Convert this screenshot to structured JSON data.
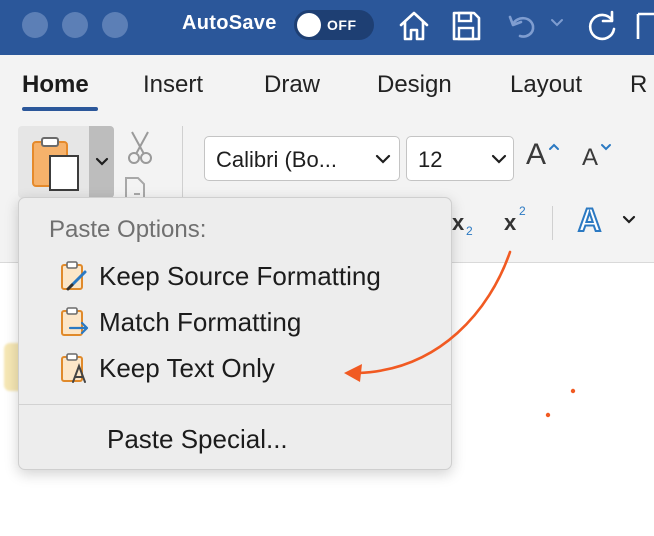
{
  "titlebar": {
    "autosave_label": "AutoSave",
    "toggle_state": "OFF"
  },
  "tabs": [
    {
      "label": "Home",
      "active": true
    },
    {
      "label": "Insert",
      "active": false
    },
    {
      "label": "Draw",
      "active": false
    },
    {
      "label": "Design",
      "active": false
    },
    {
      "label": "Layout",
      "active": false
    },
    {
      "label": "R",
      "active": false
    }
  ],
  "font": {
    "name": "Calibri (Bo...",
    "size": "12"
  },
  "format": {
    "subscript_label": "x",
    "subscript_mark": "2",
    "superscript_label": "x",
    "superscript_mark": "2",
    "grow_font": "A",
    "shrink_font": "A",
    "text_effects": "A"
  },
  "paste_menu": {
    "header": "Paste Options:",
    "items": [
      {
        "label": "Keep Source Formatting",
        "icon": "clipboard-brush-icon"
      },
      {
        "label": "Match Formatting",
        "icon": "clipboard-arrow-icon"
      },
      {
        "label": "Keep Text Only",
        "icon": "clipboard-text-icon",
        "highlighted": true
      }
    ],
    "special": "Paste Special..."
  },
  "colors": {
    "titlebar": "#2b579a",
    "annotation_arrow": "#f15a22",
    "highlight": "#f3df9b"
  }
}
